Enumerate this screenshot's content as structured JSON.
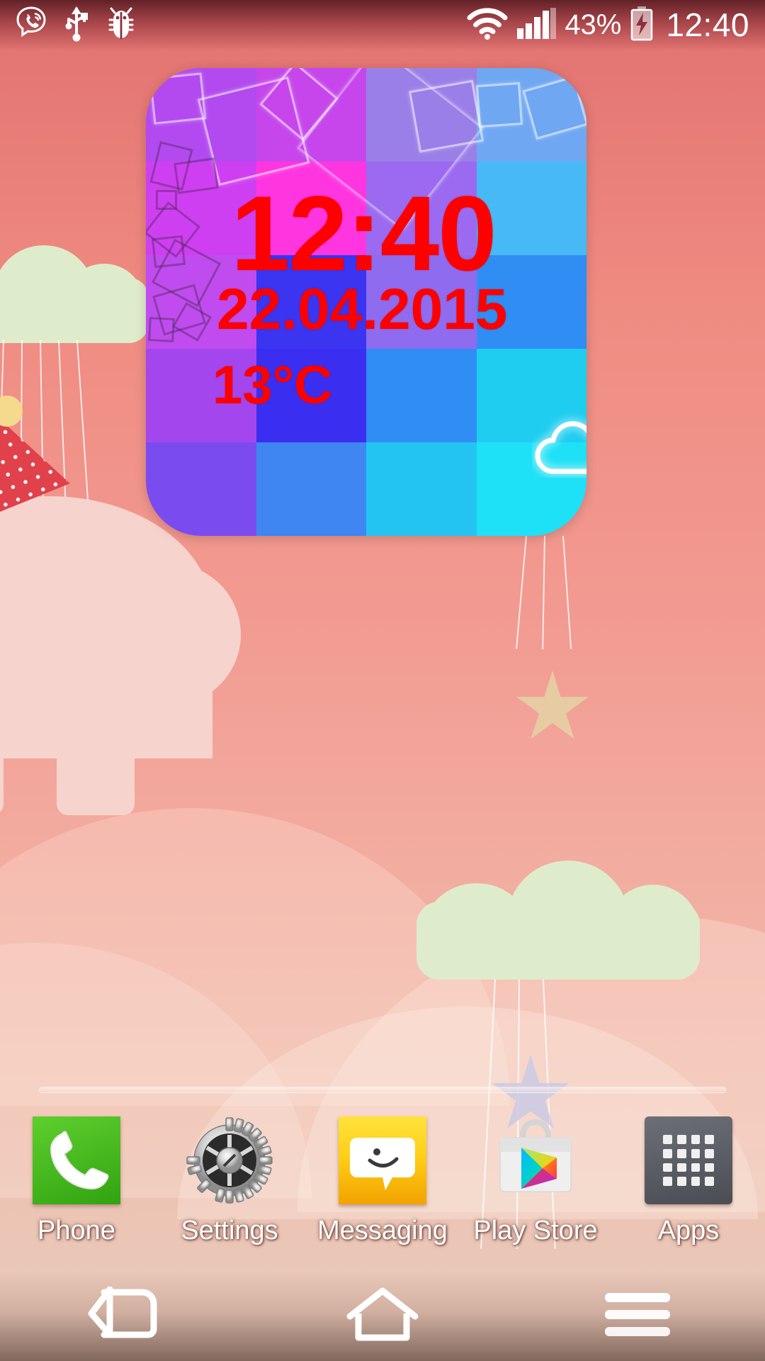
{
  "status_bar": {
    "left_icons": [
      {
        "name": "viber-icon",
        "label": "Viber"
      },
      {
        "name": "usb-icon",
        "label": "USB connected"
      },
      {
        "name": "debug-bug-icon",
        "label": "USB debugging"
      }
    ],
    "right_icons": [
      {
        "name": "wifi-icon",
        "label": "Wi-Fi"
      },
      {
        "name": "signal-bars-icon",
        "label": "Mobile signal"
      },
      {
        "name": "battery-charging-icon",
        "label": "Battery charging"
      }
    ],
    "battery_percent": "43%",
    "clock": "12:40"
  },
  "widget": {
    "name": "clock-weather-widget",
    "time": "12:40",
    "date": "22.04.2015",
    "temperature": "13°C",
    "weather_icon": "cloud-icon",
    "text_color": "#fe0000",
    "tiles": [
      "#b24af0",
      "#c646ec",
      "#9a7fe8",
      "#6fa7f2",
      "#cf3ff2",
      "#ff36e0",
      "#9b6af0",
      "#47b9f4",
      "#c04cf0",
      "#3b34f0",
      "#8f6bef",
      "#2f8df4",
      "#a446ee",
      "#3a2ff0",
      "#2f8df4",
      "#1ecdf0",
      "#7a4cef",
      "#3f86f2",
      "#23c4f2",
      "#1ee0f6"
    ]
  },
  "wallpaper": {
    "name": "elephant-balloon-wallpaper",
    "sky_color": "#ef8b81",
    "cloud_color": "#dfeccb",
    "elephant_color": "#f7d3cd",
    "hat_color": "#e0414b",
    "heart_color": "#e04552",
    "star_color": "#e6cba3"
  },
  "dock": {
    "items": [
      {
        "name": "dock-item-phone",
        "label": "Phone",
        "icon": "phone-handset-icon"
      },
      {
        "name": "dock-item-settings",
        "label": "Settings",
        "icon": "gear-icon"
      },
      {
        "name": "dock-item-messaging",
        "label": "Messaging",
        "icon": "speech-bubble-smiley-icon"
      },
      {
        "name": "dock-item-play-store",
        "label": "Play Store",
        "icon": "play-store-bag-icon"
      },
      {
        "name": "dock-item-apps",
        "label": "Apps",
        "icon": "apps-grid-icon"
      }
    ]
  },
  "nav_bar": {
    "buttons": [
      {
        "name": "nav-back-button",
        "icon": "back-arrow-icon",
        "label": "Back"
      },
      {
        "name": "nav-home-button",
        "icon": "home-house-icon",
        "label": "Home"
      },
      {
        "name": "nav-menu-button",
        "icon": "menu-lines-icon",
        "label": "Menu"
      }
    ]
  }
}
